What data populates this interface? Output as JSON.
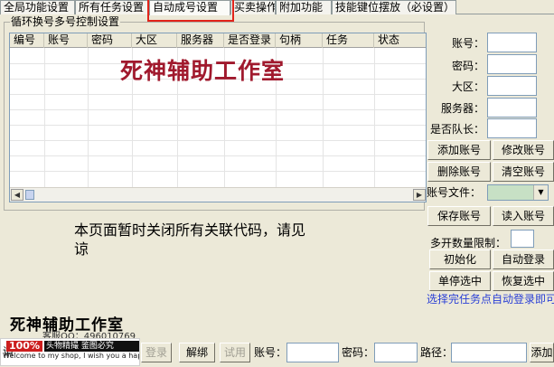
{
  "tabs": [
    {
      "label": "全局功能设置"
    },
    {
      "label": "所有任务设置"
    },
    {
      "label": "自动成号设置"
    },
    {
      "label": "买卖操作"
    },
    {
      "label": "附加功能"
    },
    {
      "label": "技能键位摆放（必设置）"
    }
  ],
  "group": {
    "title": "循环换号多号控制设置",
    "columns": [
      "编号",
      "账号",
      "密码",
      "大区",
      "服务器",
      "是否登录",
      "句柄",
      "任务",
      "状态"
    ]
  },
  "watermark": "死神辅助工作室",
  "notice": "本页面暂时关闭所有关联代码，请见谅",
  "form": {
    "account": "账号：",
    "password": "密码：",
    "region": "大区：",
    "server": "服务器：",
    "is_leader": "是否队长："
  },
  "buttons": {
    "add_account": "添加账号",
    "edit_account": "修改账号",
    "delete_account": "删除账号",
    "clear_account": "清空账号",
    "account_file_label": "账号文件：",
    "save_account": "保存账号",
    "load_account": "读入账号",
    "multi_limit_label": "多开数量限制：",
    "init": "初始化",
    "auto_login": "自动登录",
    "stop_selected": "单停选中",
    "resume_selected": "恢复选中"
  },
  "tip": "选择完任务点自动登录即可",
  "footer": {
    "studio": "死神辅助工作室",
    "qq": "客服QQ：496010769",
    "banner_badge": "100%",
    "banner_dark": "头物精撮 鉴图必究",
    "banner_welcome": "Welcome to my shop, I wish you a happy shopping!",
    "prefix": "请",
    "login": "登录",
    "unbind": "解绑",
    "trial": "试用",
    "account": "账号：",
    "password": "密码：",
    "path": "路径：",
    "add": "添加"
  }
}
